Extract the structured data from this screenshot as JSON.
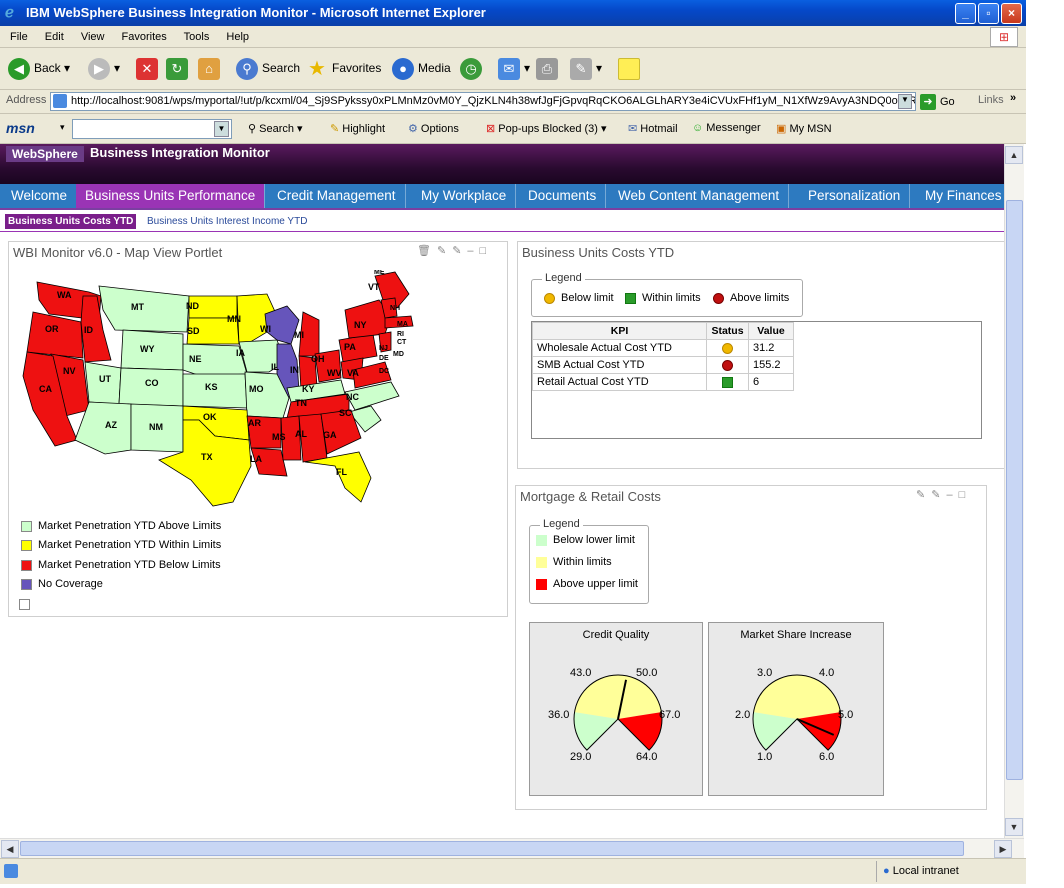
{
  "window": {
    "title": "IBM WebSphere Business Integration Monitor - Microsoft Internet Explorer",
    "buttons": [
      "_",
      "▫",
      "×"
    ]
  },
  "menu": [
    "File",
    "Edit",
    "View",
    "Favorites",
    "Tools",
    "Help"
  ],
  "toolbar": {
    "back": "Back",
    "search": "Search",
    "favorites": "Favorites",
    "media": "Media"
  },
  "address": {
    "label": "Address",
    "url": "http://localhost:9081/wps/myportal/!ut/p/kcxml/04_Sj9SPykssy0xPLMnMz0vM0Y_QjzKLN4h38wfJgFjGpvqRqCKO6ALGLhARY3e4iCVUxFHf1yM_N1XfWz9AvyA3NDQ0otwRAl",
    "go": "Go",
    "links": "Links"
  },
  "msnbar": {
    "logo": "msn",
    "search": "Search",
    "highlight": "Highlight",
    "options": "Options",
    "popups": "Pop-ups Blocked (3)",
    "hotmail": "Hotmail",
    "messenger": "Messenger",
    "mymsn": "My MSN"
  },
  "portal": {
    "logo": "WebSphere",
    "app_title": "Business Integration Monitor",
    "tabs": [
      "Welcome",
      "Business Units Performance",
      "Credit Management",
      "My Workplace",
      "Documents",
      "Web Content Management",
      "Personalization",
      "My Finances"
    ],
    "active_tab": "Business Units Performance",
    "subtabs": [
      "Business Units Costs YTD",
      "Business Units Interest Income YTD"
    ]
  },
  "map_portlet": {
    "title": "WBI Monitor v6.0 - Map View Portlet",
    "states": [
      "WA",
      "OR",
      "ID",
      "MT",
      "ND",
      "SD",
      "MN",
      "WY",
      "NE",
      "IA",
      "WI",
      "MI",
      "NY",
      "VT",
      "NH",
      "ME",
      "MA",
      "RI",
      "CT",
      "NJ",
      "DE",
      "MD",
      "DC",
      "PA",
      "OH",
      "IN",
      "IL",
      "NV",
      "CA",
      "UT",
      "CO",
      "KS",
      "MO",
      "KY",
      "WV",
      "VA",
      "NC",
      "TN",
      "SC",
      "AZ",
      "NM",
      "OK",
      "AR",
      "MS",
      "AL",
      "GA",
      "TX",
      "LA",
      "FL"
    ],
    "legend": [
      {
        "label": "Market Penetration YTD Above Limits",
        "color": "#ccffcc"
      },
      {
        "label": "Market Penetration YTD Within Limits",
        "color": "#ffff00"
      },
      {
        "label": "Market Penetration YTD Below Limits",
        "color": "#ee1111"
      },
      {
        "label": "No Coverage",
        "color": "#6655bb"
      }
    ]
  },
  "costs_portlet": {
    "title": "Business Units Costs YTD",
    "legend_title": "Legend",
    "legend": [
      "Below limit",
      "Within limits",
      "Above limits"
    ],
    "columns": [
      "KPI",
      "Status",
      "Value"
    ],
    "rows": [
      {
        "kpi": "Wholesale Actual Cost YTD",
        "status": "below",
        "value": "31.2"
      },
      {
        "kpi": "SMB Actual Cost YTD",
        "status": "above",
        "value": "155.2"
      },
      {
        "kpi": "Retail Actual Cost YTD",
        "status": "within",
        "value": "6"
      }
    ]
  },
  "mortgage_portlet": {
    "title": "Mortgage & Retail Costs",
    "legend_title": "Legend",
    "legend": [
      {
        "label": "Below lower limit",
        "color": "#ccffcc"
      },
      {
        "label": "Within limits",
        "color": "#ffff99"
      },
      {
        "label": "Above upper limit",
        "color": "#ff0000"
      }
    ],
    "gauges": [
      {
        "title": "Credit Quality",
        "labels": [
          "43.0",
          "50.0",
          "36.0",
          "67.0",
          "29.0",
          "64.0"
        ],
        "min": 29,
        "max": 64,
        "lower": 36,
        "upper": 57,
        "value": 48
      },
      {
        "title": "Market Share Increase",
        "labels": [
          "3.0",
          "4.0",
          "2.0",
          "5.0",
          "1.0",
          "6.0"
        ],
        "min": 1,
        "max": 6,
        "lower": 2,
        "upper": 5,
        "value": 5.6
      }
    ]
  },
  "status": {
    "zone": "Local intranet"
  },
  "colors": {
    "accent": "#9a34b5",
    "nav": "#2d7ac0"
  }
}
